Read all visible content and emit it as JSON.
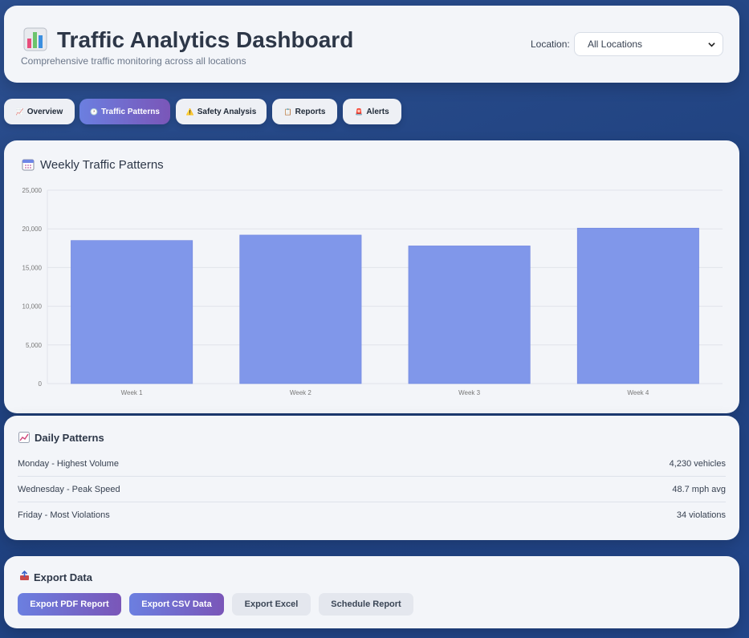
{
  "header": {
    "title": "Traffic Analytics Dashboard",
    "subtitle": "Comprehensive traffic monitoring across all locations",
    "location_label": "Location:",
    "location_selected": "All Locations"
  },
  "tabs": [
    {
      "label": "Overview",
      "icon": "chart-icon",
      "active": false
    },
    {
      "label": "Traffic Patterns",
      "icon": "clock-icon",
      "active": true
    },
    {
      "label": "Safety Analysis",
      "icon": "warning-icon",
      "active": false
    },
    {
      "label": "Reports",
      "icon": "clipboard-icon",
      "active": false
    },
    {
      "label": "Alerts",
      "icon": "siren-icon",
      "active": false
    }
  ],
  "weekly": {
    "title": "Weekly Traffic Patterns",
    "icon": "calendar-icon"
  },
  "chart_data": {
    "type": "bar",
    "categories": [
      "Week 1",
      "Week 2",
      "Week 3",
      "Week 4"
    ],
    "values": [
      18500,
      19200,
      17800,
      20100
    ],
    "ylim": [
      0,
      25000
    ],
    "yticks": [
      "0",
      "5,000",
      "10,000",
      "15,000",
      "20,000",
      "25,000"
    ],
    "ytick_values": [
      0,
      5000,
      10000,
      15000,
      20000,
      25000
    ],
    "grid": true,
    "bar_color": "#8097ea",
    "title": "",
    "xlabel": "",
    "ylabel": ""
  },
  "daily": {
    "title": "Daily Patterns",
    "icon": "trend-icon",
    "rows": [
      {
        "label": "Monday - Highest Volume",
        "value": "4,230 vehicles"
      },
      {
        "label": "Wednesday - Peak Speed",
        "value": "48.7 mph avg"
      },
      {
        "label": "Friday - Most Violations",
        "value": "34 violations"
      }
    ]
  },
  "export": {
    "title": "Export Data",
    "icon": "outbox-icon",
    "buttons": [
      {
        "label": "Export PDF Report"
      },
      {
        "label": "Export CSV Data"
      },
      {
        "label": "Export Excel"
      },
      {
        "label": "Schedule Report"
      }
    ]
  },
  "colors": {
    "accent_start": "#6b7fe0",
    "accent_end": "#7a56b8",
    "background": "#23468a",
    "card": "#f3f5f9"
  }
}
